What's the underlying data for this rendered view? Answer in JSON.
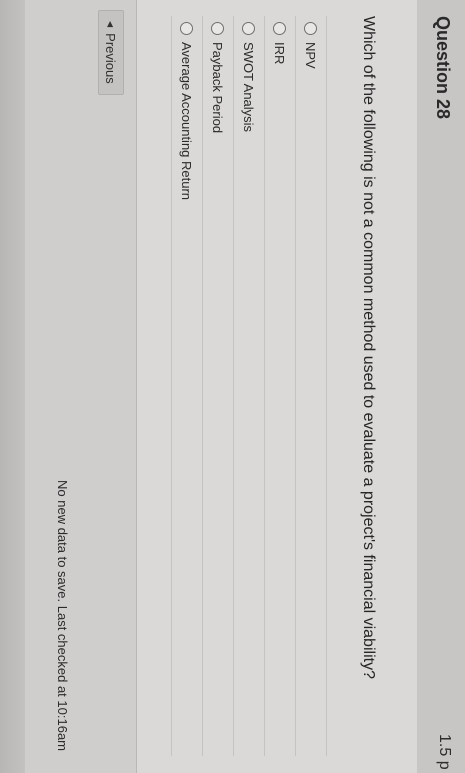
{
  "question": {
    "title": "Question 28",
    "points": "1.5 p",
    "text": "Which of the following is not a common method used to evaluate a project's financial viability?"
  },
  "options": [
    {
      "label": "NPV"
    },
    {
      "label": "IRR"
    },
    {
      "label": "SWOT Analysis"
    },
    {
      "label": "Payback Period"
    },
    {
      "label": "Average Accounting Return"
    }
  ],
  "navigation": {
    "previous_label": "Previous",
    "previous_icon": "triangle-left-icon"
  },
  "status": {
    "save_message": "No new data to save. Last checked at 10:16am"
  }
}
